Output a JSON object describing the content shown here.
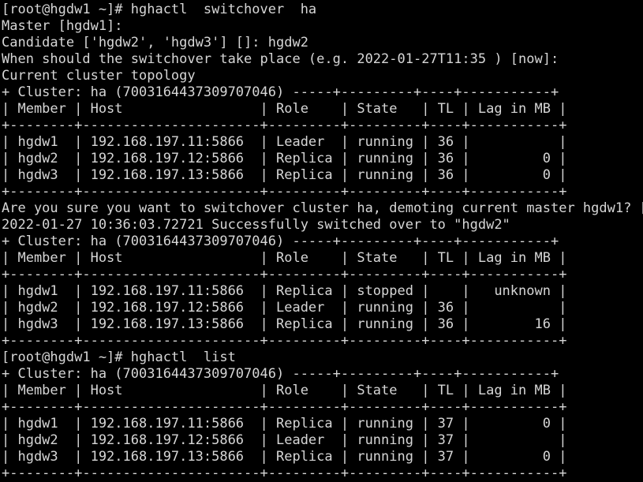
{
  "terminal": {
    "background_color": "#000000",
    "text_color": "#d6d6d6",
    "prompt": "[root@hgdw1 ~]#",
    "lines": [
      "[root@hgdw1 ~]# hghactl  switchover  ha",
      "Master [hgdw1]:",
      "Candidate ['hgdw2', 'hgdw3'] []: hgdw2",
      "When should the switchover take place (e.g. 2022-01-27T11:35 ) [now]:",
      "Current cluster topology",
      "+ Cluster: ha (7003164437309707046) -----+---------+----+-----------+",
      "| Member | Host                 | Role    | State   | TL | Lag in MB |",
      "+--------+----------------------+---------+---------+----+-----------+",
      "| hgdw1  | 192.168.197.11:5866  | Leader  | running | 36 |           |",
      "| hgdw2  | 192.168.197.12:5866  | Replica | running | 36 |         0 |",
      "| hgdw3  | 192.168.197.13:5866  | Replica | running | 36 |         0 |",
      "+--------+----------------------+---------+---------+----+-----------+",
      "Are you sure you want to switchover cluster ha, demoting current master hgdw1? [y",
      "2022-01-27 10:36:03.72721 Successfully switched over to \"hgdw2\"",
      "+ Cluster: ha (7003164437309707046) -----+---------+----+-----------+",
      "| Member | Host                 | Role    | State   | TL | Lag in MB |",
      "+--------+----------------------+---------+---------+----+-----------+",
      "| hgdw1  | 192.168.197.11:5866  | Replica | stopped |    |   unknown |",
      "| hgdw2  | 192.168.197.12:5866  | Leader  | running | 36 |           |",
      "| hgdw3  | 192.168.197.13:5866  | Replica | running | 36 |        16 |",
      "+--------+----------------------+---------+---------+----+-----------+",
      "[root@hgdw1 ~]# hghactl  list",
      "+ Cluster: ha (7003164437309707046) -----+---------+----+-----------+",
      "| Member | Host                 | Role    | State   | TL | Lag in MB |",
      "+--------+----------------------+---------+---------+----+-----------+",
      "| hgdw1  | 192.168.197.11:5866  | Replica | running | 37 |         0 |",
      "| hgdw2  | 192.168.197.12:5866  | Leader  | running | 37 |           |",
      "| hgdw3  | 192.168.197.13:5866  | Replica | running | 37 |         0 |",
      "+--------+----------------------+---------+---------+----+-----------+"
    ],
    "commands": [
      {
        "prompt": "[root@hgdw1 ~]#",
        "command": "hghactl  switchover  ha"
      },
      {
        "prompt": "[root@hgdw1 ~]#",
        "command": "hghactl  list"
      }
    ],
    "prompts": [
      {
        "label": "Master [hgdw1]:",
        "value": ""
      },
      {
        "label": "Candidate ['hgdw2', 'hgdw3'] []:",
        "value": "hgdw2"
      },
      {
        "label": "When should the switchover take place (e.g. 2022-01-27T11:35 ) [now]:",
        "value": ""
      },
      {
        "label": "Are you sure you want to switchover cluster ha, demoting current master hgdw1? [y",
        "value": ""
      }
    ],
    "status_messages": [
      "Current cluster topology",
      "2022-01-27 10:36:03.72721 Successfully switched over to \"hgdw2\""
    ],
    "cluster_id": "7003164437309707046",
    "cluster_name": "ha",
    "columns": [
      "Member",
      "Host",
      "Role",
      "State",
      "TL",
      "Lag in MB"
    ],
    "tables": [
      {
        "title": "+ Cluster: ha (7003164437309707046)",
        "rows": [
          {
            "member": "hgdw1",
            "host": "192.168.197.11:5866",
            "role": "Leader",
            "state": "running",
            "tl": "36",
            "lag": ""
          },
          {
            "member": "hgdw2",
            "host": "192.168.197.12:5866",
            "role": "Replica",
            "state": "running",
            "tl": "36",
            "lag": "0"
          },
          {
            "member": "hgdw3",
            "host": "192.168.197.13:5866",
            "role": "Replica",
            "state": "running",
            "tl": "36",
            "lag": "0"
          }
        ]
      },
      {
        "title": "+ Cluster: ha (7003164437309707046)",
        "rows": [
          {
            "member": "hgdw1",
            "host": "192.168.197.11:5866",
            "role": "Replica",
            "state": "stopped",
            "tl": "",
            "lag": "unknown"
          },
          {
            "member": "hgdw2",
            "host": "192.168.197.12:5866",
            "role": "Leader",
            "state": "running",
            "tl": "36",
            "lag": ""
          },
          {
            "member": "hgdw3",
            "host": "192.168.197.13:5866",
            "role": "Replica",
            "state": "running",
            "tl": "36",
            "lag": "16"
          }
        ]
      },
      {
        "title": "+ Cluster: ha (7003164437309707046)",
        "rows": [
          {
            "member": "hgdw1",
            "host": "192.168.197.11:5866",
            "role": "Replica",
            "state": "running",
            "tl": "37",
            "lag": "0"
          },
          {
            "member": "hgdw2",
            "host": "192.168.197.12:5866",
            "role": "Leader",
            "state": "running",
            "tl": "37",
            "lag": ""
          },
          {
            "member": "hgdw3",
            "host": "192.168.197.13:5866",
            "role": "Replica",
            "state": "running",
            "tl": "37",
            "lag": "0"
          }
        ]
      }
    ]
  }
}
